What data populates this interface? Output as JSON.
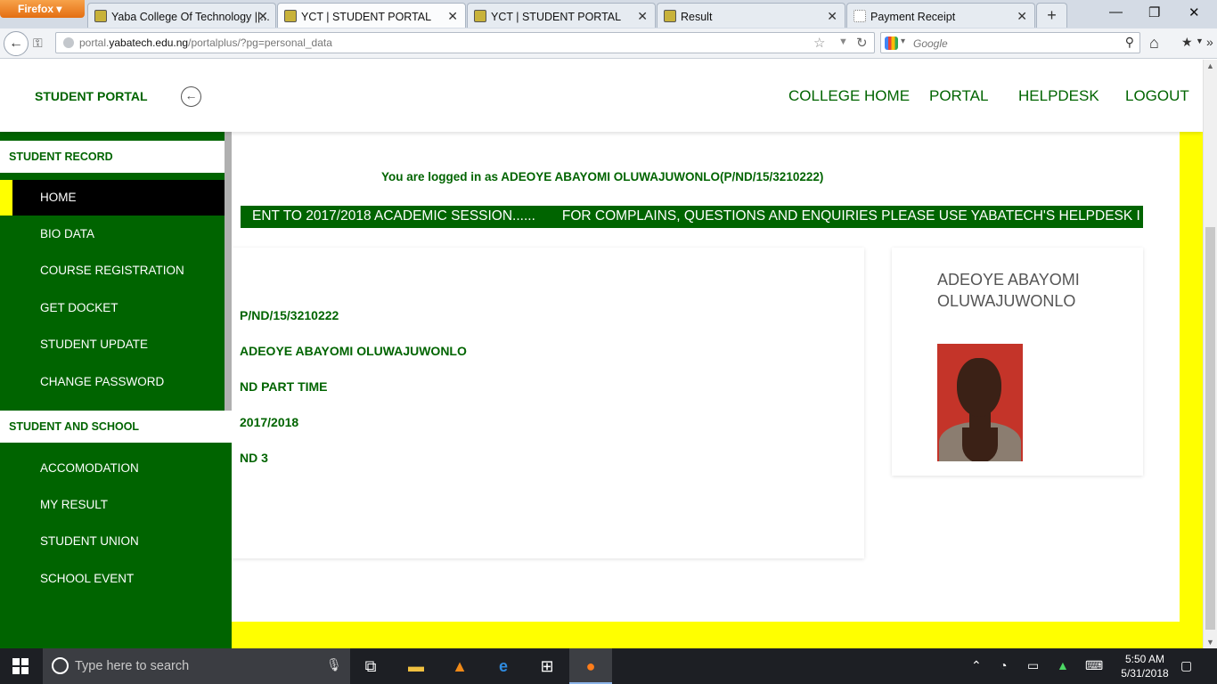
{
  "browser": {
    "menu_button": "Firefox",
    "tabs": [
      {
        "title": "Yaba College Of Technology ||..."
      },
      {
        "title": "YCT | STUDENT PORTAL"
      },
      {
        "title": "YCT | STUDENT PORTAL"
      },
      {
        "title": "Result"
      },
      {
        "title": "Payment Receipt"
      }
    ],
    "new_tab": "+",
    "url_prefix": "portal.",
    "url_domain": "yabatech.edu.ng",
    "url_path": "/portalplus/?pg=personal_data",
    "search_placeholder": "Google",
    "window_controls": {
      "minimize": "—",
      "maximize": "❐",
      "close": "✕"
    }
  },
  "header": {
    "brand": "STUDENT PORTAL",
    "nav": [
      "COLLEGE HOME",
      "PORTAL",
      "HELPDESK",
      "LOGOUT"
    ]
  },
  "sidebar": {
    "section1": "STUDENT RECORD",
    "items1": [
      "HOME",
      "BIO DATA",
      "COURSE REGISTRATION",
      "GET DOCKET",
      "STUDENT UPDATE",
      "CHANGE PASSWORD"
    ],
    "section2": "STUDENT AND SCHOOL",
    "items2": [
      "ACCOMODATION",
      "MY RESULT",
      "STUDENT UNION",
      "SCHOOL EVENT"
    ],
    "active_item": "HOME"
  },
  "main": {
    "faded_title": "STUDENT PORTAL",
    "logged_in_text": "You are logged in as ADEOYE ABAYOMI OLUWAJUWONLO(P/ND/15/3210222)",
    "marquee_part1": "ENT TO 2017/2018 ACADEMIC SESSION......",
    "marquee_part2": "FOR COMPLAINS, QUESTIONS AND ENQUIRIES PLEASE USE YABATECH'S HELPDESK I",
    "student_info": [
      "P/ND/15/3210222",
      "ADEOYE ABAYOMI OLUWAJUWONLO",
      "ND PART TIME",
      "2017/2018",
      "ND 3"
    ],
    "profile_name": "ADEOYE ABAYOMI OLUWAJUWONLO"
  },
  "taskbar": {
    "search_placeholder": "Type here to search",
    "time": "5:50 AM",
    "date": "5/31/2018"
  },
  "colors": {
    "brand_green": "#006400",
    "accent_yellow": "#ffff00",
    "active_bg": "#000000"
  }
}
